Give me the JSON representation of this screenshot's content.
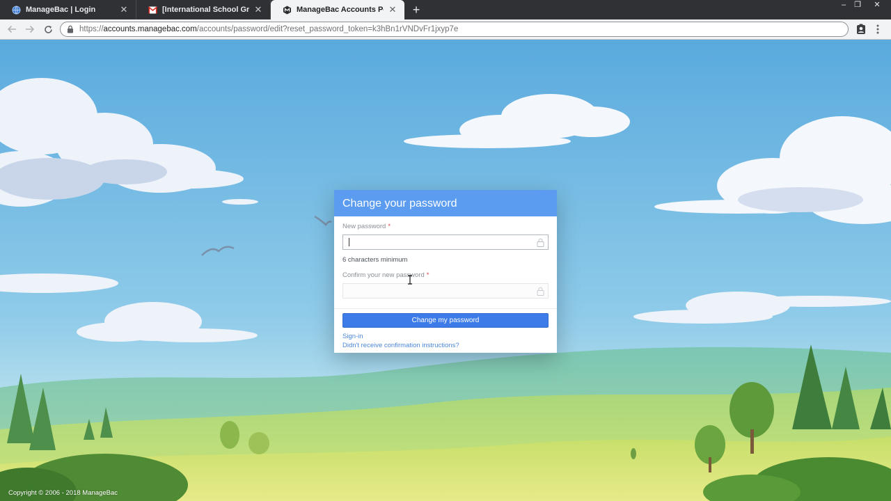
{
  "tabs": [
    {
      "title": "ManageBac | Login",
      "icon": "globe-icon",
      "active": false
    },
    {
      "title": "[International School Groninge",
      "icon": "gmail-icon",
      "active": false
    },
    {
      "title": "ManageBac Accounts Portal",
      "icon": "managebac-icon",
      "active": true
    }
  ],
  "toolbar": {
    "url_scheme": "https://",
    "url_host": "accounts.managebac.com",
    "url_path": "/accounts/password/edit?reset_password_token=k3hBn1rVNDvFr1jxyp7e"
  },
  "form": {
    "title": "Change your password",
    "new_password_label": "New password",
    "required_marker": "*",
    "new_password_value": "",
    "hint": "6 characters minimum",
    "confirm_label": "Confirm your new password",
    "confirm_value": "",
    "submit_label": "Change my password",
    "signin_link": "Sign-in",
    "confirmation_link": "Didn't receive confirmation instructions?"
  },
  "footer": {
    "copyright": "Copyright © 2006 - 2018 ManageBac"
  },
  "colors": {
    "header": "#5b9cf0",
    "button": "#3d7ce8",
    "link": "#4a87d8",
    "sky": "#6fb8e2"
  }
}
